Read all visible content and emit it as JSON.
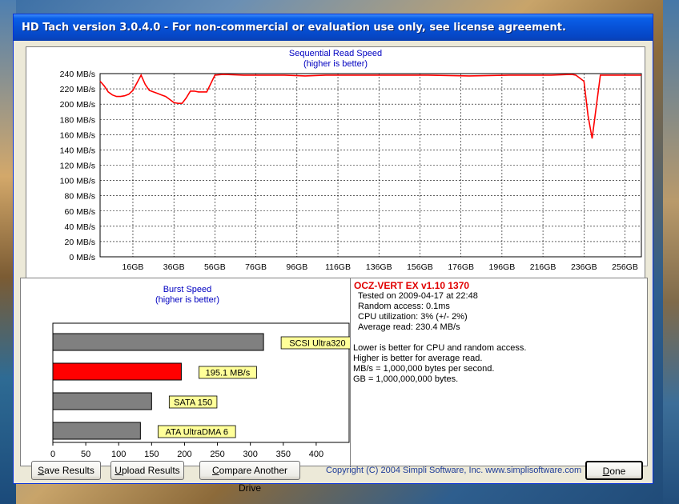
{
  "window": {
    "title": "HD Tach version 3.0.4.0  - For non-commercial or evaluation use only, see license agreement."
  },
  "sequential_chart": {
    "title": "Sequential Read Speed",
    "subtitle": "(higher is better)"
  },
  "burst_chart": {
    "title": "Burst Speed",
    "subtitle": "(higher is better)"
  },
  "info": {
    "drive_name": "OCZ-VERT EX v1.10 1370",
    "tested_on": "Tested on 2009-04-17 at 22:48",
    "random_access": "Random access: 0.1ms",
    "cpu_utilization": "CPU utilization: 3% (+/- 2%)",
    "average_read": "Average read: 230.4 MB/s",
    "notes": [
      "Lower is better for CPU and random access.",
      "Higher is better for average read.",
      "MB/s = 1,000,000 bytes per second.",
      "GB = 1,000,000,000 bytes."
    ]
  },
  "buttons": {
    "save": {
      "accel": "S",
      "rest": "ave Results"
    },
    "upload": {
      "accel": "U",
      "rest": "pload Results"
    },
    "compare": {
      "accel": "C",
      "rest": "ompare Another Drive"
    },
    "done": {
      "accel": "D",
      "rest": "one"
    }
  },
  "copyright": "Copyright (C) 2004 Simpli Software, Inc. www.simplisoftware.com",
  "colors": {
    "accent": "#ff0000",
    "bar_gray": "#808080",
    "label_yellow": "#ffff99",
    "title_blue": "#0000c0"
  },
  "chart_data": [
    {
      "type": "line",
      "title": "Sequential Read Speed",
      "subtitle": "(higher is better)",
      "xlabel": "",
      "ylabel": "",
      "ylim": [
        0,
        240
      ],
      "xlim": [
        0,
        264
      ],
      "yticks": [
        0,
        20,
        40,
        60,
        80,
        100,
        120,
        140,
        160,
        180,
        200,
        220,
        240
      ],
      "ytick_labels": [
        "0 MB/s",
        "20 MB/s",
        "40 MB/s",
        "60 MB/s",
        "80 MB/s",
        "100 MB/s",
        "120 MB/s",
        "140 MB/s",
        "160 MB/s",
        "180 MB/s",
        "200 MB/s",
        "220 MB/s",
        "240 MB/s"
      ],
      "xticks": [
        16,
        36,
        56,
        76,
        96,
        116,
        136,
        156,
        176,
        196,
        216,
        236,
        256
      ],
      "xtick_labels": [
        "16GB",
        "36GB",
        "56GB",
        "76GB",
        "96GB",
        "116GB",
        "136GB",
        "156GB",
        "176GB",
        "196GB",
        "216GB",
        "236GB",
        "256GB"
      ],
      "grid": true,
      "series": [
        {
          "color": "#ff0000",
          "x": [
            0,
            2,
            4,
            6,
            8,
            10,
            12,
            14,
            16,
            18,
            20,
            22,
            24,
            26,
            28,
            30,
            32,
            34,
            36,
            38,
            40,
            42,
            44,
            46,
            48,
            50,
            52,
            56,
            60,
            70,
            80,
            90,
            100,
            110,
            120,
            140,
            160,
            180,
            200,
            220,
            230,
            232,
            236,
            238,
            240,
            244,
            250,
            256,
            264
          ],
          "y": [
            230,
            224,
            216,
            212,
            210,
            210,
            211,
            213,
            218,
            228,
            238,
            226,
            218,
            216,
            214,
            212,
            210,
            206,
            202,
            201,
            201,
            208,
            217,
            217,
            216,
            216,
            216,
            238,
            239,
            238,
            238,
            238,
            237,
            238,
            238,
            238,
            238,
            237,
            238,
            238,
            239,
            238,
            230,
            185,
            155,
            238,
            238,
            238,
            238
          ]
        }
      ]
    },
    {
      "type": "bar",
      "orientation": "horizontal",
      "title": "Burst Speed",
      "subtitle": "(higher is better)",
      "xlim": [
        0,
        450
      ],
      "xticks": [
        0,
        50,
        100,
        150,
        200,
        250,
        300,
        350,
        400
      ],
      "categories": [
        "SCSI Ultra320",
        "195.1 MB/s",
        "SATA 150",
        "ATA UltraDMA 6"
      ],
      "values": [
        320,
        195.1,
        150,
        133
      ],
      "colors": [
        "#808080",
        "#ff0000",
        "#808080",
        "#808080"
      ]
    }
  ]
}
